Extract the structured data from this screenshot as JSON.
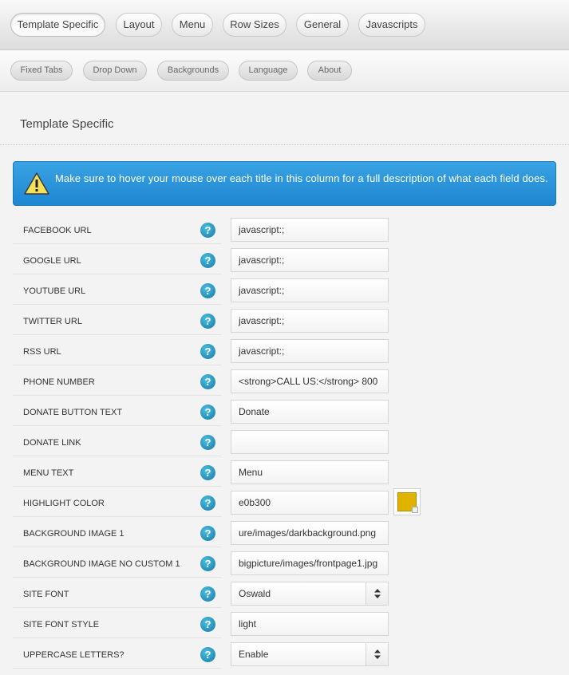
{
  "tabs": {
    "primary": [
      "Template Specific",
      "Layout",
      "Menu",
      "Row Sizes",
      "General",
      "Javascripts"
    ],
    "secondary": [
      "Fixed Tabs",
      "Drop Down",
      "Backgrounds",
      "Language",
      "About"
    ]
  },
  "section": {
    "title": "Template Specific"
  },
  "alert": {
    "text": "Make sure to hover your mouse over each title in this column for a full description of what each field does.",
    "icon": "warning-icon"
  },
  "fields": [
    {
      "label": "FACEBOOK URL",
      "value": "javascript:;"
    },
    {
      "label": "GOOGLE URL",
      "value": "javascript:;"
    },
    {
      "label": "YOUTUBE URL",
      "value": "javascript:;"
    },
    {
      "label": "TWITTER URL",
      "value": "javascript:;"
    },
    {
      "label": "RSS URL",
      "value": "javascript:;"
    },
    {
      "label": "PHONE NUMBER",
      "value": "<strong>CALL US:</strong>   800"
    },
    {
      "label": "DONATE BUTTON TEXT",
      "value": "Donate"
    },
    {
      "label": "DONATE LINK",
      "value": ""
    },
    {
      "label": "MENU TEXT",
      "value": "Menu"
    },
    {
      "label": "HIGHLIGHT COLOR",
      "value": "e0b300"
    },
    {
      "label": "BACKGROUND IMAGE 1",
      "value": "ure/images/darkbackground.png"
    },
    {
      "label": "BACKGROUND IMAGE NO CUSTOM 1",
      "value": "bigpicture/images/frontpage1.jpg"
    },
    {
      "label": "SITE FONT",
      "value": "Oswald"
    },
    {
      "label": "SITE FONT STYLE",
      "value": "light"
    },
    {
      "label": "UPPERCASE LETTERS?",
      "value": "Enable"
    }
  ],
  "colors": {
    "highlight": "#e0b300",
    "alert": "#2b95dc",
    "help": "#1a84b8"
  },
  "help_icon": "?"
}
